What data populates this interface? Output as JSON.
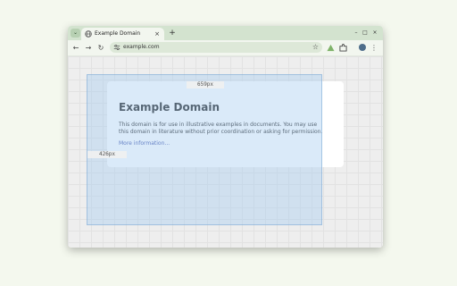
{
  "browser": {
    "tab": {
      "title": "Example Domain",
      "favicon": "globe-icon"
    },
    "new_tab_glyph": "+",
    "close_glyph": "×",
    "tab_search_glyph": "⌄",
    "window_controls": {
      "minimize": "–",
      "maximize": "□",
      "close": "×"
    },
    "toolbar": {
      "back": "←",
      "forward": "→",
      "reload": "↻",
      "address": "example.com",
      "bookmark": "☆",
      "extension_icons": [
        "triangle-warning-icon",
        "puzzle-icon"
      ],
      "menu": "⋮"
    },
    "colors": {
      "tabstrip": "#d3e3cf",
      "toolbar": "#f2f6ef",
      "omnibox": "#dde8d8",
      "overlay": "#a6cdf0",
      "link": "#3b4fa8"
    }
  },
  "page": {
    "heading": "Example Domain",
    "body": "This domain is for use in illustrative examples in documents. You may use this domain in literature without prior coordination or asking for permission.",
    "link": "More information..."
  },
  "inspector_overlay": {
    "width_label": "659px",
    "height_label": "426px"
  }
}
